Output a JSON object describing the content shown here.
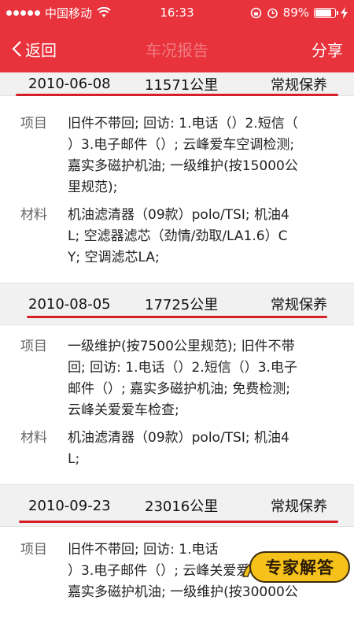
{
  "status_bar": {
    "carrier": "中国移动",
    "time": "16:33",
    "battery_percent": "89%",
    "battery_level": 0.89
  },
  "nav": {
    "back_label": "返回",
    "title": "车况报告",
    "share_label": "分享"
  },
  "labels": {
    "items": "项目",
    "materials": "材料"
  },
  "records": [
    {
      "date": "2010-06-08",
      "mileage": "11571公里",
      "type": "常规保养",
      "items_lines": [
        "旧件不带回; 回访: 1.电话（）2.短信（",
        "）3.电子邮件（）; 云峰爱车空调检测;",
        "嘉实多磁护机油; 一级维护(按15000公",
        "里规范);"
      ],
      "materials_lines": [
        "机油滤清器（09款）polo/TSI; 机油4",
        "L; 空滤器滤芯（劲情/劲取/LA1.6）C",
        "Y; 空调滤芯LA;"
      ]
    },
    {
      "date": "2010-08-05",
      "mileage": "17725公里",
      "type": "常规保养",
      "items_lines": [
        "一级维护(按7500公里规范); 旧件不带",
        "回; 回访: 1.电话（）2.短信（）3.电子",
        "邮件（）; 嘉实多磁护机油; 免费检测;",
        "云峰关爱爱车检查;"
      ],
      "materials_lines": [
        "机油滤清器（09款）polo/TSI; 机油4",
        "L;"
      ]
    },
    {
      "date": "2010-09-23",
      "mileage": "23016公里",
      "type": "常规保养",
      "items_lines": [
        "旧件不带回; 回访: 1.电话",
        "）3.电子邮件（）; 云峰关爱爱车检查;",
        "嘉实多磁护机油; 一级维护(按30000公"
      ]
    }
  ],
  "badge": {
    "text": "专家解答"
  },
  "colors": {
    "header_red": "#e8323c",
    "underline_red": "#d61f27",
    "badge_yellow": "#f6c11a"
  }
}
